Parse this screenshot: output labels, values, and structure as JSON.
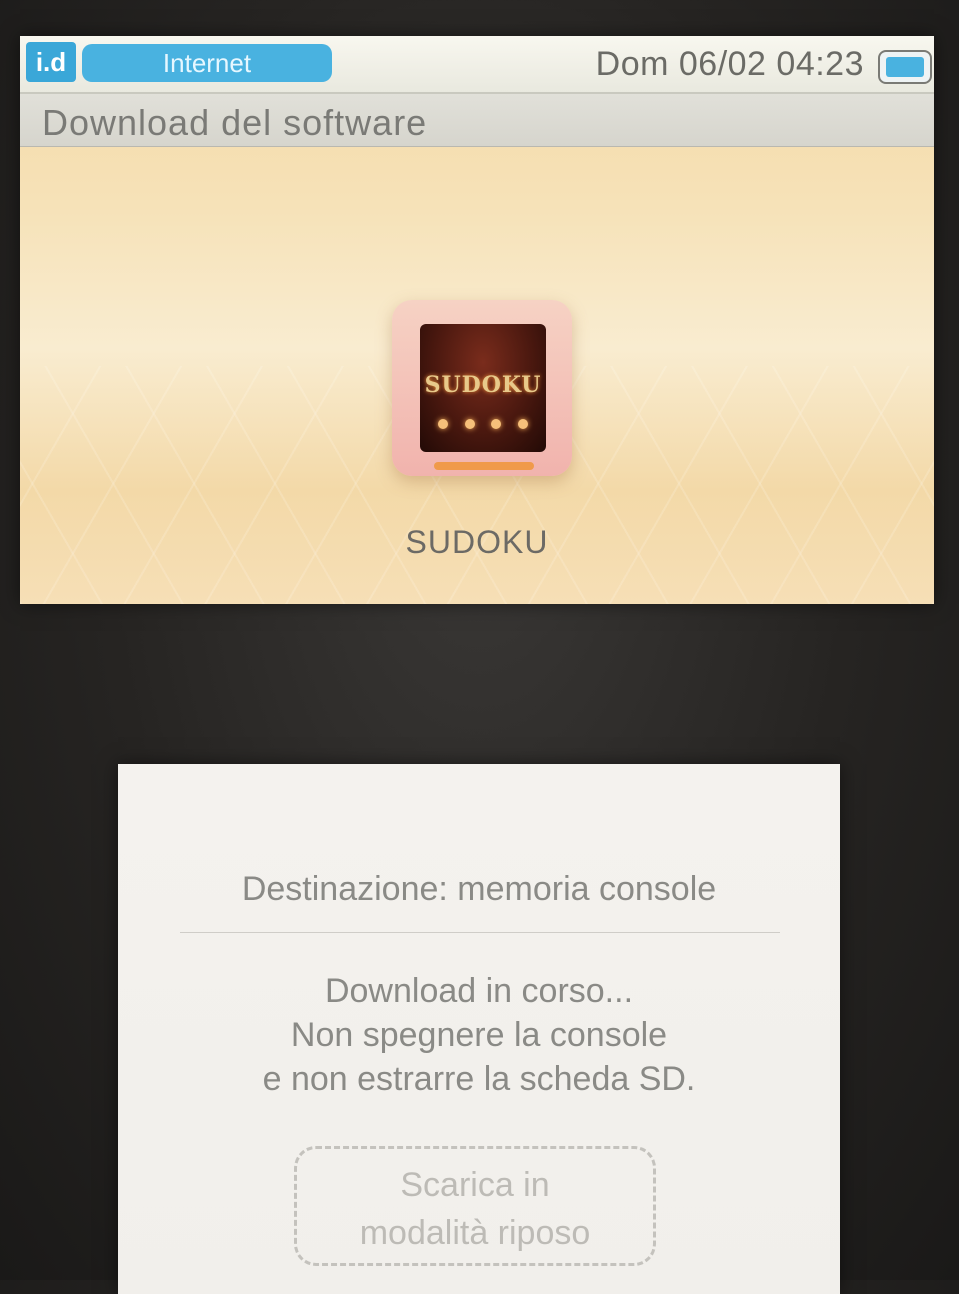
{
  "status_bar": {
    "signal_label": "i.d",
    "connection_label": "Internet",
    "datetime": "Dom 06/02 04:23"
  },
  "header": {
    "title": "Download del software"
  },
  "app": {
    "name": "SUDOKU",
    "icon_text": "SUDOKU"
  },
  "download": {
    "destination": "Destinazione: memoria console",
    "line1": "Download in corso...",
    "line2": "Non spegnere la console",
    "line3": "e non estrarre la scheda SD.",
    "sleep_button_line1": "Scarica in",
    "sleep_button_line2": "modalità riposo"
  },
  "colors": {
    "accent": "#49b2e0",
    "top_background": "#f6e2b8",
    "bottom_background": "#f2f0ec"
  },
  "icons": [
    "signal-icon",
    "battery-icon",
    "app-icon"
  ]
}
